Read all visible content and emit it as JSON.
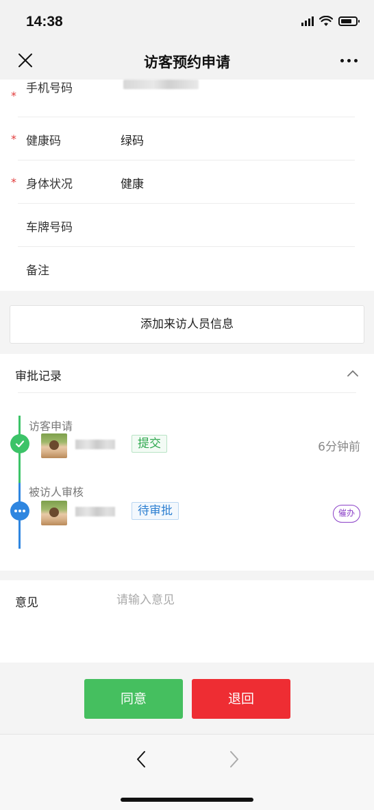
{
  "status_bar": {
    "time": "14:38",
    "icons": [
      "signal-icon",
      "wifi-icon",
      "battery-icon"
    ]
  },
  "nav": {
    "close_icon": "close-icon",
    "title": "访客预约申请",
    "more_icon": "more-icon"
  },
  "form": {
    "rows": [
      {
        "label": "手机号码",
        "required": true,
        "value": ""
      },
      {
        "label": "健康码",
        "required": true,
        "value": "绿码"
      },
      {
        "label": "身体状况",
        "required": true,
        "value": "健康"
      },
      {
        "label": "车牌号码",
        "required": false,
        "value": ""
      },
      {
        "label": "备注",
        "required": false,
        "value": ""
      }
    ],
    "required_mark": "*"
  },
  "add_visitor": {
    "label": "添加来访人员信息"
  },
  "approval": {
    "title": "审批记录",
    "steps": [
      {
        "title": "访客申请",
        "tag": "提交",
        "time": "6分钟前",
        "status_color": "#3cc368"
      },
      {
        "title": "被访人审核",
        "tag": "待审批",
        "badge": "催办",
        "status_color": "#2f86e0"
      }
    ]
  },
  "opinion": {
    "label": "意见",
    "placeholder": "请输入意见",
    "value": ""
  },
  "actions": {
    "agree": "同意",
    "return": "退回"
  },
  "colors": {
    "agree": "#45bf5f",
    "return": "#ee2d33",
    "required": "#e23b3b",
    "urge": "#8a3fc7"
  }
}
